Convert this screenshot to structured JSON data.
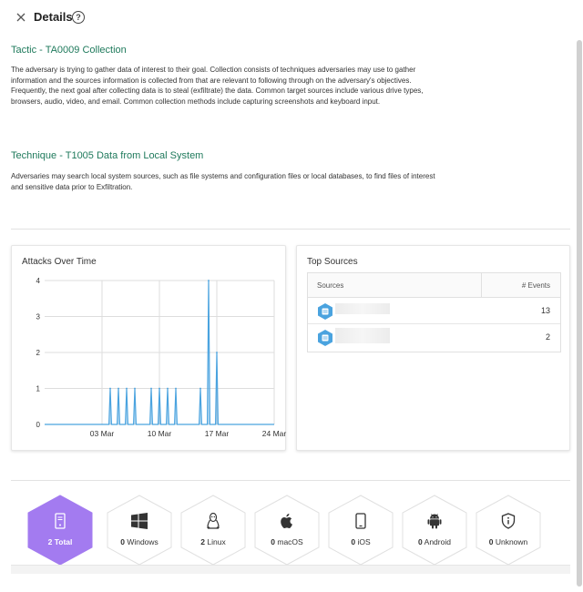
{
  "header": {
    "title": "Details",
    "help_icon": "?"
  },
  "tactic": {
    "heading": "Tactic - TA0009 Collection",
    "description": "The adversary is trying to gather data of interest to their goal. Collection consists of techniques adversaries may use to gather information and the sources information is collected from that are relevant to following through on the adversary's objectives. Frequently, the next goal after collecting data is to steal (exfiltrate) the data. Common target sources include various drive types, browsers, audio, video, and email. Common collection methods include capturing screenshots and keyboard input."
  },
  "technique": {
    "heading": "Technique - T1005 Data from Local System",
    "description": "Adversaries may search local system sources, such as file systems and configuration files or local databases, to find files of interest and sensitive data prior to Exfiltration."
  },
  "attacks_card": {
    "title": "Attacks Over Time"
  },
  "chart_data": {
    "type": "area",
    "title": "Attacks Over Time",
    "x_tick_labels": [
      "03 Mar",
      "10 Mar",
      "17 Mar",
      "24 Mar"
    ],
    "y_ticks": [
      0,
      1,
      2,
      3,
      4
    ],
    "ylim": [
      0,
      4
    ],
    "grid": true,
    "color": "#4aa3df",
    "series": [
      {
        "values": [
          {
            "x": "2024-02-25",
            "y": 0
          },
          {
            "x": "2024-03-04",
            "y": 1
          },
          {
            "x": "2024-03-05",
            "y": 1
          },
          {
            "x": "2024-03-06",
            "y": 1
          },
          {
            "x": "2024-03-07",
            "y": 1
          },
          {
            "x": "2024-03-09",
            "y": 1
          },
          {
            "x": "2024-03-10",
            "y": 1
          },
          {
            "x": "2024-03-11",
            "y": 1
          },
          {
            "x": "2024-03-12",
            "y": 1
          },
          {
            "x": "2024-03-15",
            "y": 1
          },
          {
            "x": "2024-03-16",
            "y": 4
          },
          {
            "x": "2024-03-17",
            "y": 2
          },
          {
            "x": "2024-03-24",
            "y": 0
          }
        ]
      }
    ]
  },
  "sources_card": {
    "title": "Top Sources",
    "col_sources": "Sources",
    "col_events": "# Events",
    "rows": [
      {
        "icon": "server-icon",
        "count": "13"
      },
      {
        "icon": "server-icon",
        "count": "2"
      }
    ]
  },
  "os_filters": [
    {
      "name": "total",
      "count": "2",
      "label": "Total",
      "icon": "device-icon",
      "active": true
    },
    {
      "name": "windows",
      "count": "0",
      "label": "Windows",
      "icon": "windows-icon",
      "active": false
    },
    {
      "name": "linux",
      "count": "2",
      "label": "Linux",
      "icon": "linux-icon",
      "active": false
    },
    {
      "name": "macos",
      "count": "0",
      "label": "macOS",
      "icon": "apple-icon",
      "active": false
    },
    {
      "name": "ios",
      "count": "0",
      "label": "iOS",
      "icon": "phone-icon",
      "active": false
    },
    {
      "name": "android",
      "count": "0",
      "label": "Android",
      "icon": "android-icon",
      "active": false
    },
    {
      "name": "unknown",
      "count": "0",
      "label": "Unknown",
      "icon": "shield-icon",
      "active": false
    }
  ],
  "colors": {
    "accent": "#1f7a5c",
    "active_hex": "#a37bf0",
    "chart": "#4aa3df"
  }
}
